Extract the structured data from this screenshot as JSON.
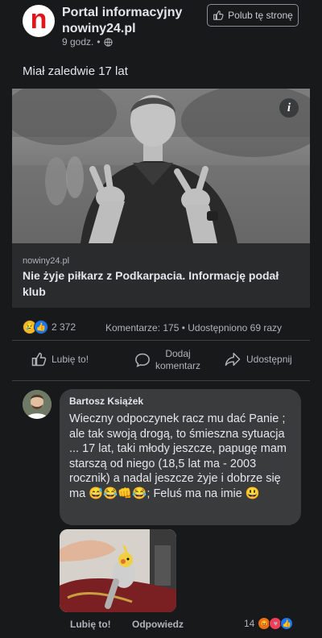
{
  "post": {
    "page_logo": "n",
    "page_name": "Portal informacyjny nowiny24.pl",
    "time": "9 godz.",
    "globe_icon": "globe-icon",
    "like_page_label": "Polub tę stronę",
    "text": "Miał zaledwie 17 lat",
    "photo_info": "i",
    "link_domain": "nowiny24.pl",
    "link_title": "Nie żyje piłkarz z Podkarpacia. Informację podał klub",
    "reaction_count": "2 372",
    "stats": "Komentarze: 175 • Udostępniono 69 razy",
    "actions": {
      "like": "Lubię to!",
      "comment": "Dodaj komentarz",
      "share": "Udostępnij"
    }
  },
  "comment": {
    "author": "Bartosz Książek",
    "text": "Wieczny odpoczynek racz mu dać Panie ; ale tak swoją drogą, to śmieszna sytuacja ... 17 lat, taki młody jeszcze, papugę mam starszą od niego (18,5 lat ma - 2003 rocznik) a nadal jeszcze żyje i dobrze się ma 😅😂👊😂; Feluś ma na imie 😃",
    "like": "Lubię to!",
    "reply": "Odpowiedz",
    "reaction_count": "14"
  },
  "colors": {
    "background": "#18191a",
    "brand_red": "#e0161b",
    "like_blue": "#1877f2"
  }
}
